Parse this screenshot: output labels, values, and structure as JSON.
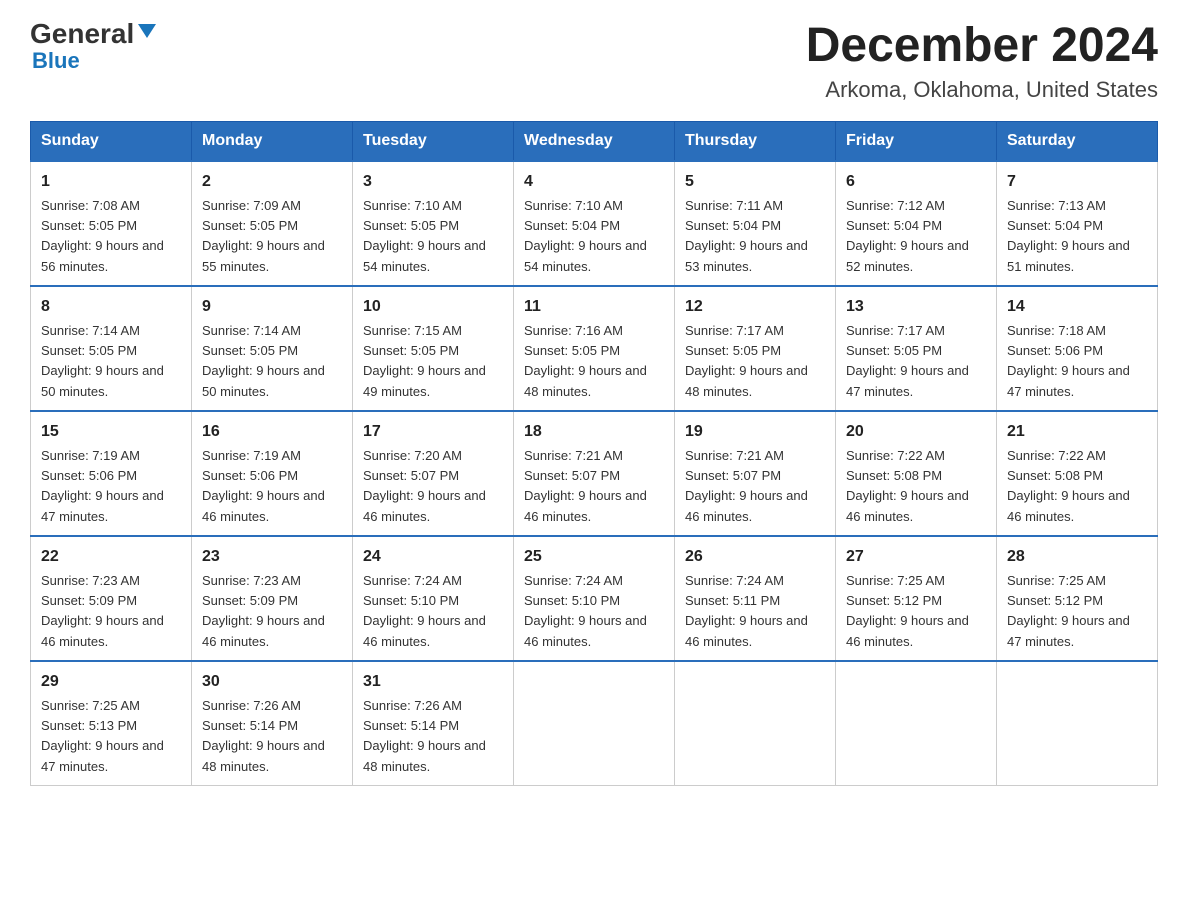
{
  "logo": {
    "general": "General",
    "blue": "Blue",
    "triangle": "▶"
  },
  "title": "December 2024",
  "location": "Arkoma, Oklahoma, United States",
  "days_of_week": [
    "Sunday",
    "Monday",
    "Tuesday",
    "Wednesday",
    "Thursday",
    "Friday",
    "Saturday"
  ],
  "weeks": [
    [
      {
        "day": "1",
        "sunrise": "7:08 AM",
        "sunset": "5:05 PM",
        "daylight": "9 hours and 56 minutes."
      },
      {
        "day": "2",
        "sunrise": "7:09 AM",
        "sunset": "5:05 PM",
        "daylight": "9 hours and 55 minutes."
      },
      {
        "day": "3",
        "sunrise": "7:10 AM",
        "sunset": "5:05 PM",
        "daylight": "9 hours and 54 minutes."
      },
      {
        "day": "4",
        "sunrise": "7:10 AM",
        "sunset": "5:04 PM",
        "daylight": "9 hours and 54 minutes."
      },
      {
        "day": "5",
        "sunrise": "7:11 AM",
        "sunset": "5:04 PM",
        "daylight": "9 hours and 53 minutes."
      },
      {
        "day": "6",
        "sunrise": "7:12 AM",
        "sunset": "5:04 PM",
        "daylight": "9 hours and 52 minutes."
      },
      {
        "day": "7",
        "sunrise": "7:13 AM",
        "sunset": "5:04 PM",
        "daylight": "9 hours and 51 minutes."
      }
    ],
    [
      {
        "day": "8",
        "sunrise": "7:14 AM",
        "sunset": "5:05 PM",
        "daylight": "9 hours and 50 minutes."
      },
      {
        "day": "9",
        "sunrise": "7:14 AM",
        "sunset": "5:05 PM",
        "daylight": "9 hours and 50 minutes."
      },
      {
        "day": "10",
        "sunrise": "7:15 AM",
        "sunset": "5:05 PM",
        "daylight": "9 hours and 49 minutes."
      },
      {
        "day": "11",
        "sunrise": "7:16 AM",
        "sunset": "5:05 PM",
        "daylight": "9 hours and 48 minutes."
      },
      {
        "day": "12",
        "sunrise": "7:17 AM",
        "sunset": "5:05 PM",
        "daylight": "9 hours and 48 minutes."
      },
      {
        "day": "13",
        "sunrise": "7:17 AM",
        "sunset": "5:05 PM",
        "daylight": "9 hours and 47 minutes."
      },
      {
        "day": "14",
        "sunrise": "7:18 AM",
        "sunset": "5:06 PM",
        "daylight": "9 hours and 47 minutes."
      }
    ],
    [
      {
        "day": "15",
        "sunrise": "7:19 AM",
        "sunset": "5:06 PM",
        "daylight": "9 hours and 47 minutes."
      },
      {
        "day": "16",
        "sunrise": "7:19 AM",
        "sunset": "5:06 PM",
        "daylight": "9 hours and 46 minutes."
      },
      {
        "day": "17",
        "sunrise": "7:20 AM",
        "sunset": "5:07 PM",
        "daylight": "9 hours and 46 minutes."
      },
      {
        "day": "18",
        "sunrise": "7:21 AM",
        "sunset": "5:07 PM",
        "daylight": "9 hours and 46 minutes."
      },
      {
        "day": "19",
        "sunrise": "7:21 AM",
        "sunset": "5:07 PM",
        "daylight": "9 hours and 46 minutes."
      },
      {
        "day": "20",
        "sunrise": "7:22 AM",
        "sunset": "5:08 PM",
        "daylight": "9 hours and 46 minutes."
      },
      {
        "day": "21",
        "sunrise": "7:22 AM",
        "sunset": "5:08 PM",
        "daylight": "9 hours and 46 minutes."
      }
    ],
    [
      {
        "day": "22",
        "sunrise": "7:23 AM",
        "sunset": "5:09 PM",
        "daylight": "9 hours and 46 minutes."
      },
      {
        "day": "23",
        "sunrise": "7:23 AM",
        "sunset": "5:09 PM",
        "daylight": "9 hours and 46 minutes."
      },
      {
        "day": "24",
        "sunrise": "7:24 AM",
        "sunset": "5:10 PM",
        "daylight": "9 hours and 46 minutes."
      },
      {
        "day": "25",
        "sunrise": "7:24 AM",
        "sunset": "5:10 PM",
        "daylight": "9 hours and 46 minutes."
      },
      {
        "day": "26",
        "sunrise": "7:24 AM",
        "sunset": "5:11 PM",
        "daylight": "9 hours and 46 minutes."
      },
      {
        "day": "27",
        "sunrise": "7:25 AM",
        "sunset": "5:12 PM",
        "daylight": "9 hours and 46 minutes."
      },
      {
        "day": "28",
        "sunrise": "7:25 AM",
        "sunset": "5:12 PM",
        "daylight": "9 hours and 47 minutes."
      }
    ],
    [
      {
        "day": "29",
        "sunrise": "7:25 AM",
        "sunset": "5:13 PM",
        "daylight": "9 hours and 47 minutes."
      },
      {
        "day": "30",
        "sunrise": "7:26 AM",
        "sunset": "5:14 PM",
        "daylight": "9 hours and 48 minutes."
      },
      {
        "day": "31",
        "sunrise": "7:26 AM",
        "sunset": "5:14 PM",
        "daylight": "9 hours and 48 minutes."
      },
      null,
      null,
      null,
      null
    ]
  ]
}
